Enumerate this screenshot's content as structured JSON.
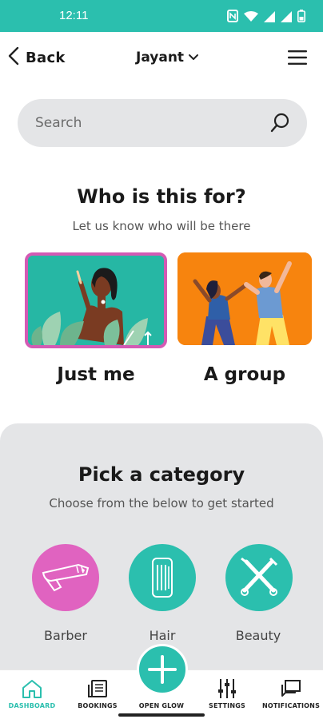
{
  "status_bar": {
    "time": "12:11",
    "icons": [
      "nfc-icon",
      "wifi-icon",
      "signal-icon",
      "signal-icon",
      "battery-icon"
    ]
  },
  "header": {
    "back_label": "Back",
    "user_name": "Jayant",
    "icons": {
      "back": "chevron-left-icon",
      "user_dropdown": "chevron-down-icon",
      "menu": "hamburger-menu-icon"
    }
  },
  "search": {
    "placeholder": "Search",
    "icon": "search-icon"
  },
  "who": {
    "title": "Who is this for?",
    "subtitle": "Let us know who will be there",
    "options": [
      {
        "label": "Just me",
        "selected": true
      },
      {
        "label": "A group",
        "selected": false
      }
    ]
  },
  "category": {
    "title": "Pick a category",
    "subtitle": "Choose from the below to get started",
    "items": [
      {
        "label": "Barber",
        "icon": "razor-icon"
      },
      {
        "label": "Hair",
        "icon": "comb-icon"
      },
      {
        "label": "Beauty",
        "icon": "makeup-brushes-icon"
      }
    ]
  },
  "bottom_nav": {
    "items": [
      {
        "label": "DASHBOARD",
        "icon": "home-icon",
        "active": true
      },
      {
        "label": "BOOKINGS",
        "icon": "bookings-icon",
        "active": false
      },
      {
        "label": "OPEN GLOW",
        "icon": "plus-icon",
        "active": false
      },
      {
        "label": "SETTINGS",
        "icon": "sliders-icon",
        "active": false
      },
      {
        "label": "NOTIFICATIONS",
        "icon": "chat-icon",
        "active": false
      }
    ]
  },
  "colors": {
    "accent": "#2bbfae",
    "pink": "#d45ab4",
    "orange": "#f7840e",
    "panel_bg": "#e4e5e7"
  }
}
